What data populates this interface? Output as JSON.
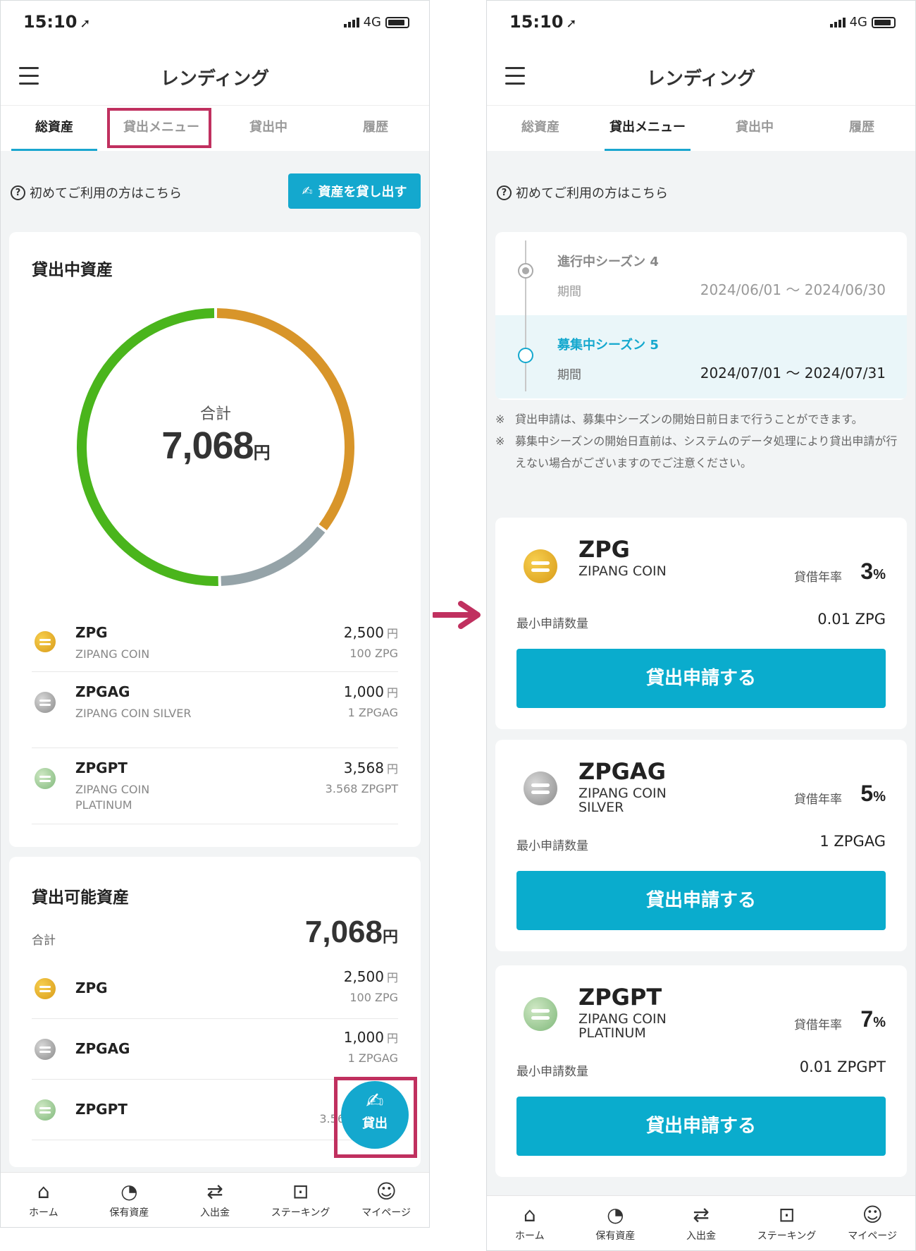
{
  "status": {
    "time": "15:10",
    "location_arrow": "➚",
    "network": "4G"
  },
  "header": {
    "title": "レンディング",
    "menu_icon": "hamburger-icon"
  },
  "tabs": [
    {
      "label": "総資産"
    },
    {
      "label": "貸出メニュー"
    },
    {
      "label": "貸出中"
    },
    {
      "label": "履歴"
    }
  ],
  "left_active_tab": "総資産",
  "right_active_tab": "貸出メニュー",
  "help": {
    "text": "初めてご利用の方はこちら",
    "lend_button": "資産を貸し出す"
  },
  "lending_assets": {
    "title": "貸出中資産",
    "total_label": "合計",
    "total_value": "7,068",
    "unit": "円",
    "chart_data": {
      "type": "pie",
      "categories": [
        "ZPG",
        "ZPGAG",
        "ZPGPT"
      ],
      "values": [
        2500,
        1000,
        3568
      ],
      "colors": [
        "#d8952a",
        "#95a3a8",
        "#4ab51c"
      ]
    },
    "items": [
      {
        "symbol": "ZPG",
        "name": "ZIPANG COIN",
        "yen": "2,500",
        "yen_unit": "円",
        "qty": "100 ZPG",
        "coin": "gold"
      },
      {
        "symbol": "ZPGAG",
        "name": "ZIPANG COIN SILVER",
        "yen": "1,000",
        "yen_unit": "円",
        "qty": "1 ZPGAG",
        "coin": "silver"
      },
      {
        "symbol": "ZPGPT",
        "name": "ZIPANG COIN PLATINUM",
        "yen": "3,568",
        "yen_unit": "円",
        "qty": "3.568 ZPGPT",
        "coin": "platinum"
      }
    ]
  },
  "available_assets": {
    "title": "貸出可能資産",
    "total_label": "合計",
    "total_value": "7,068",
    "unit": "円",
    "items": [
      {
        "symbol": "ZPG",
        "yen": "2,500",
        "yen_unit": "円",
        "qty": "100 ZPG"
      },
      {
        "symbol": "ZPGAG",
        "yen": "1,000",
        "yen_unit": "円",
        "qty": "1 ZPGAG"
      },
      {
        "symbol": "ZPGPT",
        "yen": "",
        "yen_unit": "",
        "qty": "3.56"
      }
    ]
  },
  "fab": {
    "label": "貸出"
  },
  "nav": [
    {
      "label": "ホーム",
      "icon": "home-icon",
      "glyph": "⌂"
    },
    {
      "label": "保有資産",
      "icon": "pie-chart-icon",
      "glyph": "◔"
    },
    {
      "label": "入出金",
      "icon": "transfer-icon",
      "glyph": "⇄"
    },
    {
      "label": "ステーキング",
      "icon": "staking-icon",
      "glyph": "⊡"
    },
    {
      "label": "マイページ",
      "icon": "user-icon",
      "glyph": "☺"
    }
  ],
  "seasons": [
    {
      "name": "進行中シーズン 4",
      "period_label": "期間",
      "period": "2024/06/01 〜 2024/06/30",
      "state": "ongoing"
    },
    {
      "name": "募集中シーズン 5",
      "period_label": "期間",
      "period": "2024/07/01 〜 2024/07/31",
      "state": "recruiting"
    }
  ],
  "notes": [
    {
      "mark": "※",
      "text": "貸出申請は、募集中シーズンの開始日前日まで行うことができます。"
    },
    {
      "mark": "※",
      "text": "募集中シーズンの開始日直前は、システムのデータ処理により貸出申請が行えない場合がございますのでご注意ください。"
    }
  ],
  "products": [
    {
      "symbol": "ZPG",
      "name": "ZIPANG COIN",
      "rate_label": "貸借年率",
      "rate": "3",
      "rate_unit": "%",
      "min_label": "最小申請数量",
      "min_value": "0.01 ZPG",
      "button": "貸出申請する",
      "coin": "gold"
    },
    {
      "symbol": "ZPGAG",
      "name": "ZIPANG COIN SILVER",
      "rate_label": "貸借年率",
      "rate": "5",
      "rate_unit": "%",
      "min_label": "最小申請数量",
      "min_value": "1 ZPGAG",
      "button": "貸出申請する",
      "coin": "silver"
    },
    {
      "symbol": "ZPGPT",
      "name": "ZIPANG COIN PLATINUM",
      "rate_label": "貸借年率",
      "rate": "7",
      "rate_unit": "%",
      "min_label": "最小申請数量",
      "min_value": "0.01 ZPGPT",
      "button": "貸出申請する",
      "coin": "platinum"
    }
  ],
  "colors": {
    "accent": "#14a8ce",
    "highlight": "#c0305f",
    "arrow": "#c0305f"
  }
}
